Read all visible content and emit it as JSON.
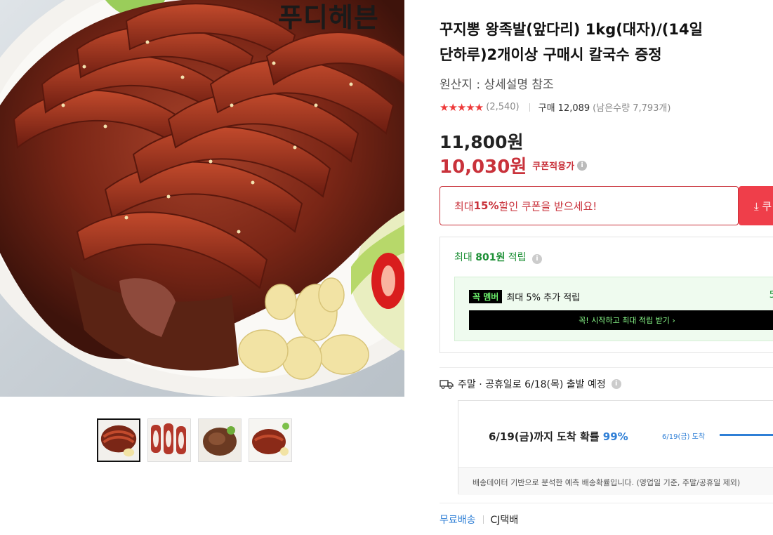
{
  "product": {
    "image_brand": "푸디헤븐",
    "title": "꾸지뽕 왕족발(앞다리) 1kg(대자)/(14일 단하루)2개이상 구매시 칼국수 증정",
    "origin": "원산지 : 상세설명 참조",
    "rating_stars": "★★★★★",
    "rating_value": 4.5,
    "rating_count": "(2,540)",
    "sold_label": "구매 12,089",
    "stock_label": "(남은수량 7,793개)",
    "price_original": "11,800원",
    "price_sale": "10,030원",
    "coupon_applied_label": "쿠폰적용가",
    "thumbnails": [
      "thumb-1",
      "thumb-2",
      "thumb-3",
      "thumb-4"
    ]
  },
  "coupon": {
    "text_prefix": "최대 ",
    "text_bold": "15%",
    "text_suffix": " 할인 쿠폰을 받으세요!",
    "button_label": "⤓ 쿠"
  },
  "reward": {
    "max_prefix": "최대 ",
    "max_amount": "801원",
    "max_suffix": " 적립",
    "member_badge": "꼭",
    "member_badge_2": "멤버",
    "member_text": "최대 5% 추가 적립",
    "member_side": "5",
    "member_cta": "꼭! 시작하고 최대 적립 받기 ›"
  },
  "shipping": {
    "notice": "주말 · 공휴일로 6/18(목) 출발 예정",
    "arrival_prefix": "6/19(금)까지 도착 확률 ",
    "arrival_pct": "99%",
    "arrival_date": "6/19(금) 도착",
    "arrival_note": "배송데이터 기반으로 분석한 예측 배송확률입니다. (영업일 기준, 주말/공휴일 제외)",
    "free_shipping": "무료배송",
    "carrier": "CJ택배"
  },
  "colors": {
    "sale_red": "#c9323b",
    "reward_green": "#1c8f35",
    "link_blue": "#2f7fd6"
  }
}
